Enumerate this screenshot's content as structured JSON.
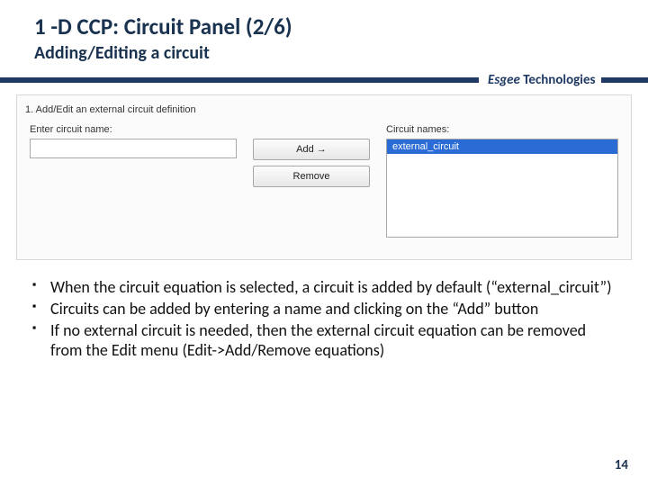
{
  "title": "1 -D CCP: Circuit Panel (2/6)",
  "subtitle": "Adding/Editing a circuit",
  "brand": {
    "italic": "Esgee",
    "bold": "Technologies"
  },
  "panel": {
    "group_caption": "1. Add/Edit an external circuit definition",
    "enter_label": "Enter circuit name:",
    "enter_value": "",
    "add_label": "Add →",
    "remove_label": "Remove",
    "names_label": "Circuit names:",
    "circuits": [
      "external_circuit"
    ]
  },
  "bullets": [
    "When the circuit equation is selected, a circuit is added by default (“external_circuit”)",
    "Circuits can be added by entering a name and clicking on the “Add” button",
    "If no external circuit is needed, then the external circuit equation can be removed from the Edit menu (Edit->Add/Remove equations)"
  ],
  "page_number": "14"
}
